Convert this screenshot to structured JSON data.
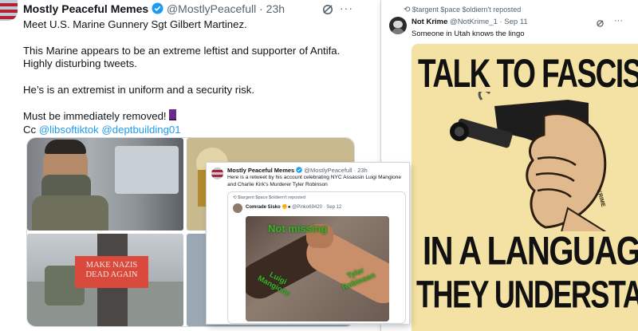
{
  "left_tweet": {
    "display_name": "Mostly Peaceful Memes",
    "handle": "@MostlyPeacefull",
    "time": "· 23h",
    "line1": "Meet U.S. Marine Gunnery Sgt Gilbert Martinez.",
    "line2": "This Marine appears to be an extreme leftist and supporter of Antifa. Highly disturbing tweets.",
    "line3": "He’s is an extremist in uniform and a security risk.",
    "line4": "Must be immediately removed!",
    "cc_label": "Cc",
    "mention1": "@libsoftiktok",
    "mention2": "@deptbuilding01",
    "sticker_text": "MAKE NAZIS DEAD AGAIN"
  },
  "overlay_tweet": {
    "display_name": "Mostly Peaceful Memes",
    "handle": "@MostlyPeacefull · 23h",
    "text": "Here is a retweet by his account celebrating NYC Assassin Luigi Mangione and Charlie Kirk’s Murderer Tyler Robinson",
    "repost_label": "$targent $pace $oldiern't reposted",
    "inner_name": "Comrade Sisko",
    "inner_handle": "@Pinko69420 · Sep 12",
    "meme_top": "Not missing",
    "meme_left": "Luigi Mangione",
    "meme_right": "Tyler Robinson"
  },
  "right_tweet": {
    "repost_label": "$targent $pace $oldiern't reposted",
    "display_name": "Not Krime",
    "handle": "@NotKrime_1 · Sep 11",
    "text": "Someone in Utah knows the lingo",
    "poster_top": "TALK TO FASCISTS",
    "poster_bottom1": "IN A LANGUAGE",
    "poster_bottom2": "THEY UNDERSTAND",
    "poster_signature": "KRIME"
  },
  "colors": {
    "link": "#1d9bf0",
    "muted": "#536471",
    "verified": "#1d9bf0",
    "poster_bg": "#f3e2a3",
    "meme_green": "#3fae2a",
    "sticker_red": "#d94a3d"
  }
}
